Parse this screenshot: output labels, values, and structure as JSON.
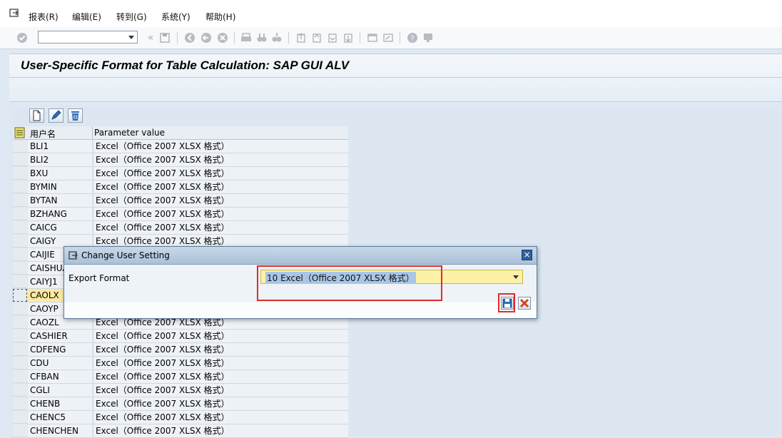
{
  "menubar": {
    "items": [
      "报表(R)",
      "编辑(E)",
      "转到(G)",
      "系统(Y)",
      "帮助(H)"
    ]
  },
  "toolbar": {
    "command_field_value": ""
  },
  "page": {
    "title": "User-Specific Format for Table Calculation: SAP GUI ALV"
  },
  "grid": {
    "columns": [
      "用户名",
      "Parameter value"
    ],
    "rows": [
      {
        "user": "BLI1",
        "value": "Excel（Office 2007 XLSX 格式）"
      },
      {
        "user": "BLI2",
        "value": "Excel（Office 2007 XLSX 格式）"
      },
      {
        "user": "BXU",
        "value": "Excel（Office 2007 XLSX 格式）"
      },
      {
        "user": "BYMIN",
        "value": "Excel（Office 2007 XLSX 格式）"
      },
      {
        "user": "BYTAN",
        "value": "Excel（Office 2007 XLSX 格式）"
      },
      {
        "user": "BZHANG",
        "value": "Excel（Office 2007 XLSX 格式）"
      },
      {
        "user": "CAICG",
        "value": "Excel（Office 2007 XLSX 格式）"
      },
      {
        "user": "CAIGY",
        "value": "Excel（Office 2007 XLSX 格式）"
      },
      {
        "user": "CAIJIE",
        "value": ""
      },
      {
        "user": "CAISHUA",
        "value": ""
      },
      {
        "user": "CAIYJ1",
        "value": ""
      },
      {
        "user": "CAOLX",
        "value": ""
      },
      {
        "user": "CAOYP",
        "value": ""
      },
      {
        "user": "CAOZL",
        "value": "Excel（Office 2007 XLSX 格式）"
      },
      {
        "user": "CASHIER",
        "value": "Excel（Office 2007 XLSX 格式）"
      },
      {
        "user": "CDFENG",
        "value": "Excel（Office 2007 XLSX 格式）"
      },
      {
        "user": "CDU",
        "value": "Excel（Office 2007 XLSX 格式）"
      },
      {
        "user": "CFBAN",
        "value": "Excel（Office 2007 XLSX 格式）"
      },
      {
        "user": "CGLI",
        "value": "Excel（Office 2007 XLSX 格式）"
      },
      {
        "user": "CHENB",
        "value": "Excel（Office 2007 XLSX 格式）"
      },
      {
        "user": "CHENC5",
        "value": "Excel（Office 2007 XLSX 格式）"
      },
      {
        "user": "CHENCHEN",
        "value": "Excel（Office 2007 XLSX 格式）"
      }
    ],
    "selected_index": 11
  },
  "dialog": {
    "title": "Change User Setting",
    "field_label": "Export Format",
    "field_value": "10 Excel（Office 2007 XLSX 格式）"
  },
  "colors": {
    "highlight": "#e12b2b",
    "selected_row": "#fde9a2",
    "input_bg": "#fbf1a7"
  }
}
